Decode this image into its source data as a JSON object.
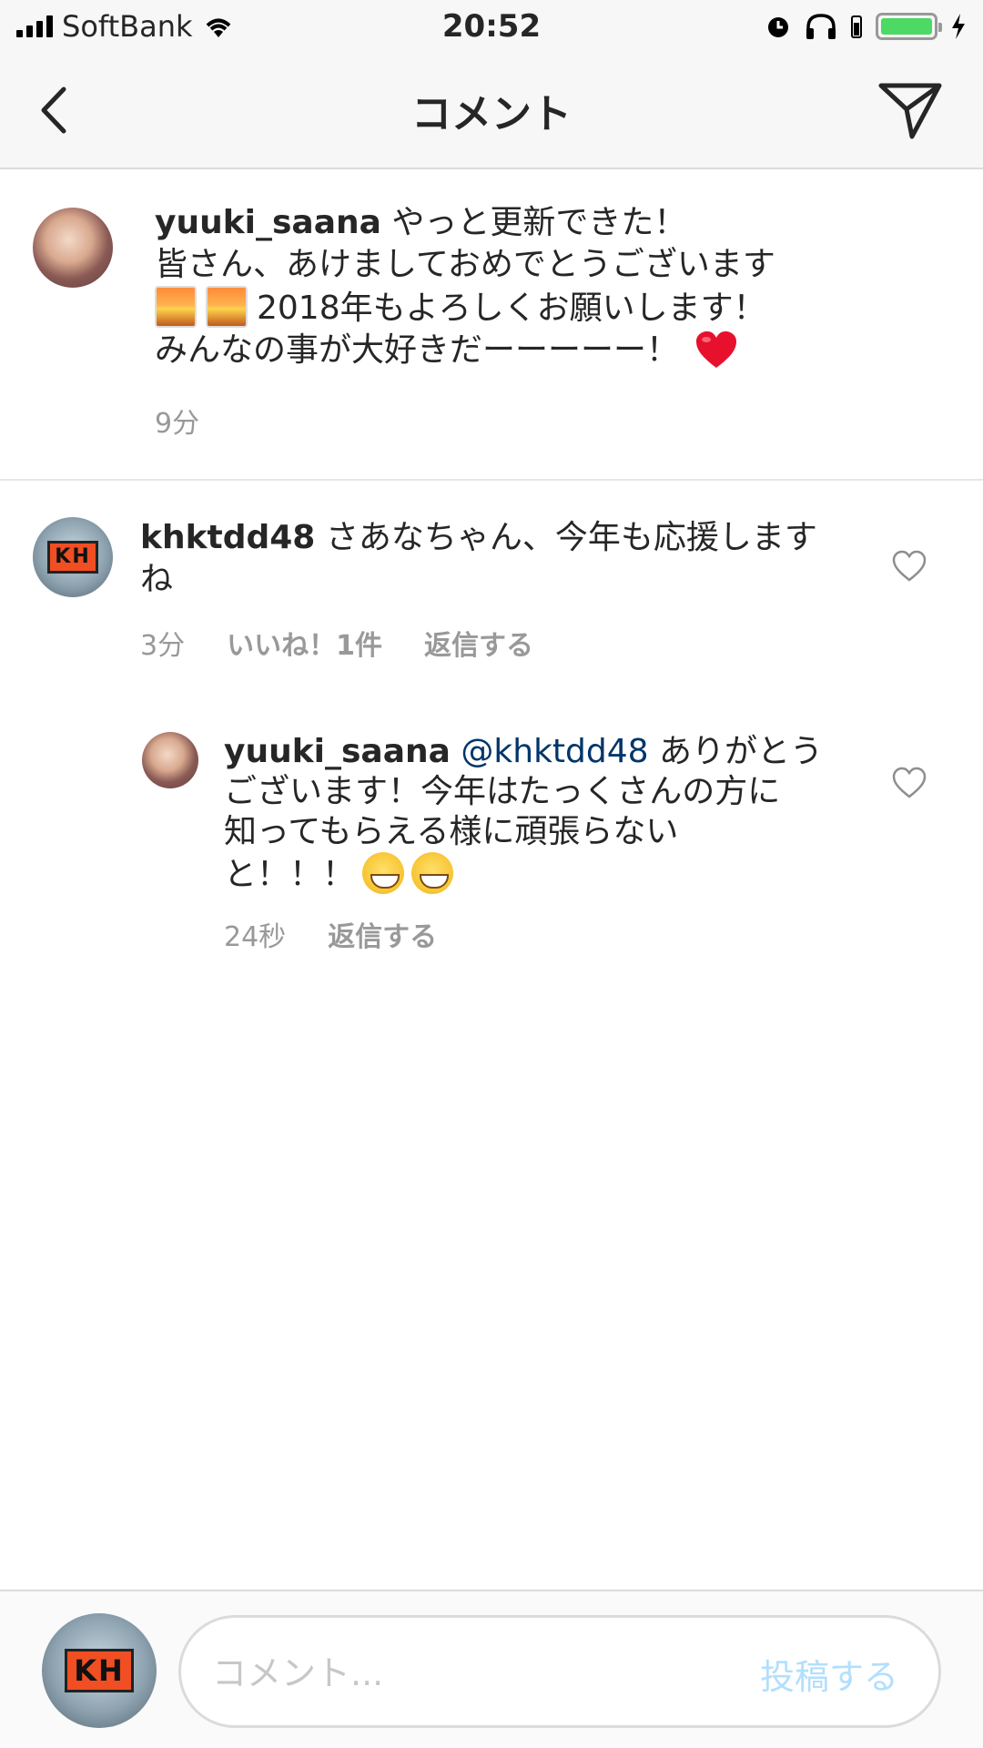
{
  "status_bar": {
    "carrier": "SoftBank",
    "time": "20:52",
    "battery_color": "#4cd964"
  },
  "nav": {
    "title": "コメント",
    "back_icon": "chevron-left-icon",
    "direct_icon": "paper-plane-icon"
  },
  "caption": {
    "username": "yuuki_saana",
    "line1": "やっと更新できた！",
    "line2": "皆さん、あけましておめでとうございます",
    "line3": "2018年もよろしくお願いします！",
    "line4": "みんなの事が大好きだーーーーー！",
    "time": "9分"
  },
  "comments": [
    {
      "username": "khktdd48",
      "text_line1": "さあなちゃん、今年も応援します",
      "text_line2": "ね",
      "time": "3分",
      "likes": "いいね！1件",
      "reply": "返信する"
    }
  ],
  "replies": [
    {
      "username": "yuuki_saana",
      "mention": "@khktdd48",
      "text_line1": "ありがとう",
      "text_line2": "ございます！今年はたっくさんの方に",
      "text_line3": "知ってもらえる様に頑張らない",
      "text_line4": "と！！！",
      "time": "24秒",
      "reply": "返信する"
    }
  ],
  "composer": {
    "placeholder": "コメント...",
    "post_label": "投稿する",
    "post_color": "#b2dffc"
  },
  "avatar_badge": "KH"
}
